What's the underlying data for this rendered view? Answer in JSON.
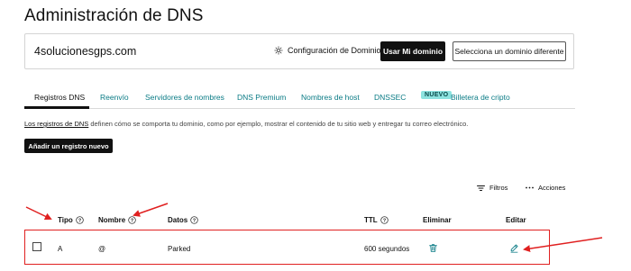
{
  "page": {
    "title": "Administración de DNS"
  },
  "domain": {
    "name": "4solucionesgps.com",
    "config_label": "Configuración de Dominio",
    "use_button": "Usar Mi dominio",
    "select_other_button": "Selecciona un dominio diferente",
    "config_icon": "gear-icon"
  },
  "tabs": [
    {
      "label": "Registros DNS",
      "active": true
    },
    {
      "label": "Reenvío"
    },
    {
      "label": "Servidores de nombres"
    },
    {
      "label": "DNS Premium"
    },
    {
      "label": "Nombres de host"
    },
    {
      "label": "DNSSEC"
    },
    {
      "label": "Billetera de cripto",
      "badge": "NUEVO"
    }
  ],
  "description": {
    "link": "Los registros de DNS",
    "text": " definen cómo se comporta tu dominio, como por ejemplo, mostrar el contenido de tu sitio web y entregar tu correo electrónico."
  },
  "add_button": "Añadir un registro nuevo",
  "toolbar": {
    "filters": "Filtros",
    "actions": "Acciones"
  },
  "table": {
    "headers": {
      "type": "Tipo",
      "name": "Nombre",
      "data": "Datos",
      "ttl": "TTL",
      "delete": "Eliminar",
      "edit": "Editar"
    },
    "rows": [
      {
        "type": "A",
        "name": "@",
        "data": "Parked",
        "ttl": "600 segundos"
      }
    ]
  },
  "colors": {
    "accent": "#0a7b85",
    "highlight": "#e02020",
    "badge": "#8de3e0",
    "button_dark": "#111111"
  }
}
